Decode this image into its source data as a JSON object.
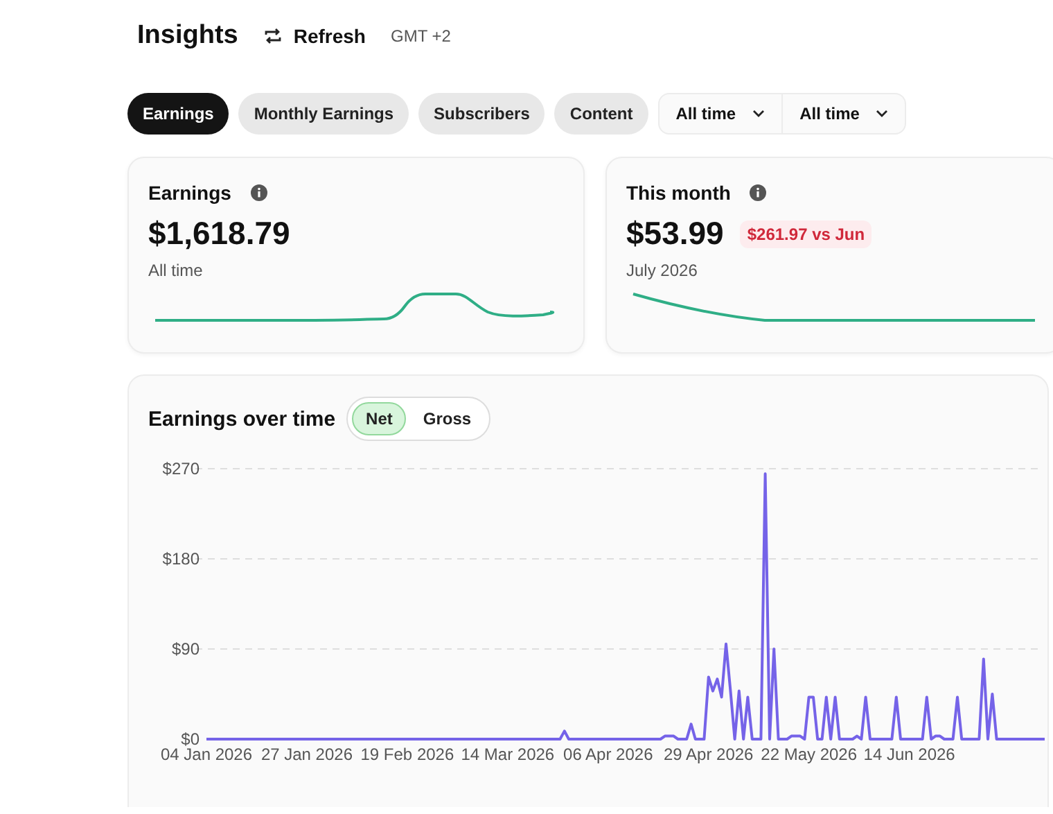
{
  "header": {
    "title": "Insights",
    "refresh": "Refresh",
    "timezone": "GMT +2"
  },
  "tabs": [
    {
      "label": "Earnings",
      "selected": true
    },
    {
      "label": "Monthly Earnings",
      "selected": false
    },
    {
      "label": "Subscribers",
      "selected": false
    },
    {
      "label": "Content",
      "selected": false
    }
  ],
  "filters": [
    "All time",
    "All time"
  ],
  "cards": [
    {
      "title": "Earnings",
      "value": "$1,618.79",
      "caption": "All time",
      "kind": "bump"
    },
    {
      "title": "This month",
      "value": "$53.99",
      "badge": "$261.97 vs Jun",
      "caption": "July 2026",
      "kind": "decline"
    }
  ],
  "earnings_chart": {
    "title": "Earnings over time",
    "toggle": [
      {
        "label": "Net",
        "selected": true
      },
      {
        "label": "Gross",
        "selected": false
      }
    ],
    "chart_data": {
      "type": "line",
      "categories": [
        "04 Jan 2026",
        null,
        null,
        null,
        null,
        null,
        null,
        null,
        null,
        null,
        null,
        null,
        null,
        null,
        null,
        null,
        null,
        null,
        null,
        null,
        null,
        null,
        null,
        "27 Jan 2026",
        null,
        null,
        null,
        null,
        null,
        null,
        null,
        null,
        null,
        null,
        null,
        null,
        null,
        null,
        null,
        null,
        null,
        null,
        null,
        null,
        null,
        null,
        "19 Feb 2026",
        null,
        null,
        null,
        null,
        null,
        null,
        null,
        null,
        null,
        null,
        null,
        null,
        null,
        null,
        null,
        null,
        null,
        null,
        null,
        null,
        null,
        null,
        "14 Mar 2026",
        null,
        null,
        null,
        null,
        null,
        null,
        null,
        null,
        null,
        null,
        null,
        null,
        null,
        null,
        null,
        null,
        null,
        null,
        null,
        null,
        null,
        null,
        "06 Apr 2026",
        null,
        null,
        null,
        null,
        null,
        null,
        null,
        null,
        null,
        null,
        null,
        null,
        null,
        null,
        null,
        null,
        null,
        null,
        null,
        null,
        null,
        null,
        "29 Apr 2026",
        null,
        null,
        null,
        null,
        null,
        null,
        null,
        null,
        null,
        null,
        null,
        null,
        null,
        null,
        null,
        null,
        null,
        null,
        null,
        null,
        null,
        null,
        "22 May 2026",
        null,
        null,
        null,
        null,
        null,
        null,
        null,
        null,
        null,
        null,
        null,
        null,
        null,
        null,
        null,
        null,
        null,
        null,
        null,
        null,
        null,
        null,
        "14 Jun 2026",
        null,
        null,
        null,
        null,
        null,
        null,
        null,
        null,
        null,
        null,
        null,
        null,
        null,
        null,
        null,
        null,
        null,
        null,
        null,
        null,
        null,
        null,
        null,
        null,
        null,
        null,
        null,
        null,
        null,
        null,
        null
      ],
      "series": [
        {
          "color": "#7563e8",
          "values": [
            0,
            0,
            0,
            0,
            0,
            0,
            0,
            0,
            0,
            0,
            0,
            0,
            0,
            0,
            0,
            0,
            0,
            0,
            0,
            0,
            0,
            0,
            0,
            0,
            0,
            0,
            0,
            0,
            0,
            0,
            0,
            0,
            0,
            0,
            0,
            0,
            0,
            0,
            0,
            0,
            0,
            0,
            0,
            0,
            0,
            0,
            0,
            0,
            0,
            0,
            0,
            0,
            0,
            0,
            0,
            0,
            0,
            0,
            0,
            0,
            0,
            0,
            0,
            0,
            0,
            0,
            0,
            0,
            0,
            0,
            0,
            0,
            0,
            0,
            0,
            0,
            0,
            0,
            0,
            0,
            0,
            0,
            8,
            0,
            0,
            0,
            0,
            0,
            0,
            0,
            0,
            0,
            0,
            0,
            0,
            0,
            0,
            0,
            0,
            0,
            0,
            0,
            0,
            0,
            0,
            3,
            3,
            3,
            0,
            0,
            0,
            15,
            0,
            0,
            0,
            62,
            48,
            60,
            42,
            95,
            50,
            0,
            48,
            0,
            42,
            0,
            0,
            0,
            265,
            0,
            90,
            0,
            0,
            0,
            3,
            3,
            3,
            0,
            42,
            42,
            0,
            0,
            42,
            0,
            42,
            0,
            0,
            0,
            0,
            3,
            0,
            42,
            0,
            0,
            0,
            0,
            0,
            0,
            42,
            0,
            0,
            0,
            0,
            0,
            0,
            42,
            0,
            3,
            3,
            0,
            0,
            0,
            42,
            0,
            0,
            0,
            0,
            0,
            80,
            0,
            45,
            0,
            0,
            0,
            0,
            0,
            0,
            0,
            0,
            0,
            0,
            0,
            0
          ]
        }
      ],
      "ylim": [
        0,
        270
      ],
      "yticks": [
        {
          "value": 0,
          "label": "$0"
        },
        {
          "value": 90,
          "label": "$90"
        },
        {
          "value": 180,
          "label": "$180"
        },
        {
          "value": 270,
          "label": "$270"
        }
      ]
    }
  }
}
